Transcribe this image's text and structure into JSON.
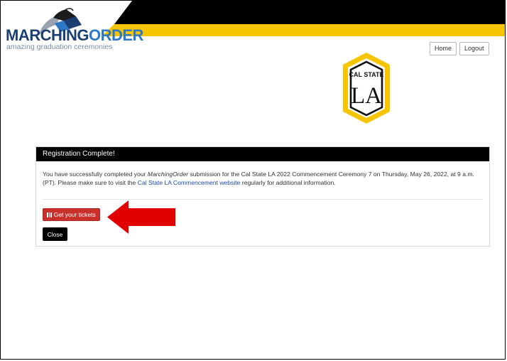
{
  "brand": {
    "name_part1": "MARCHING",
    "name_part2": "ORDER",
    "tagline": "amazing graduation ceremonies"
  },
  "nav": {
    "home_label": "Home",
    "logout_label": "Logout"
  },
  "school_logo": {
    "line1": "CAL STATE",
    "line2": "LA"
  },
  "panel": {
    "title": "Registration Complete!",
    "message": {
      "part1": "You have successfully completed your ",
      "product": "MarchingOrder",
      "part2": " submission for the Cal State LA 2022 Commencement Ceremony 7 on Thursday, May 26, 2022, at 9 a.m. (PT). Please make sure to visit the ",
      "link_text": "Cal State LA Commencement website",
      "part3": " regularly for additional information."
    },
    "tickets_button_label": "Get your tickets",
    "close_button_label": "Close"
  },
  "colors": {
    "banner_black": "#000000",
    "banner_yellow": "#f6c500",
    "brand_dark_blue": "#1b3f72",
    "brand_blue": "#2e78c8",
    "tickets_red": "#c9302c",
    "arrow_red": "#e00000",
    "link_blue": "#1a4ba8"
  },
  "icons": {
    "logo": "graduation-cap-icon",
    "tickets": "ticket-icon",
    "annotation": "arrow-left-icon"
  }
}
